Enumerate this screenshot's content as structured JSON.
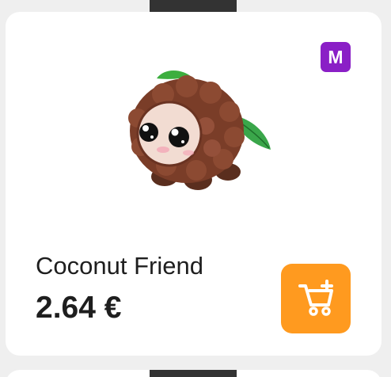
{
  "item": {
    "rarity_badge": "M",
    "rarity_color": "#8a1fc6",
    "name": "Coconut Friend",
    "price": "2.64 €",
    "image_icon": "coconut-friend-pet-icon"
  },
  "actions": {
    "add_to_cart_icon": "cart-plus-icon",
    "button_color": "#ff9a1f"
  }
}
